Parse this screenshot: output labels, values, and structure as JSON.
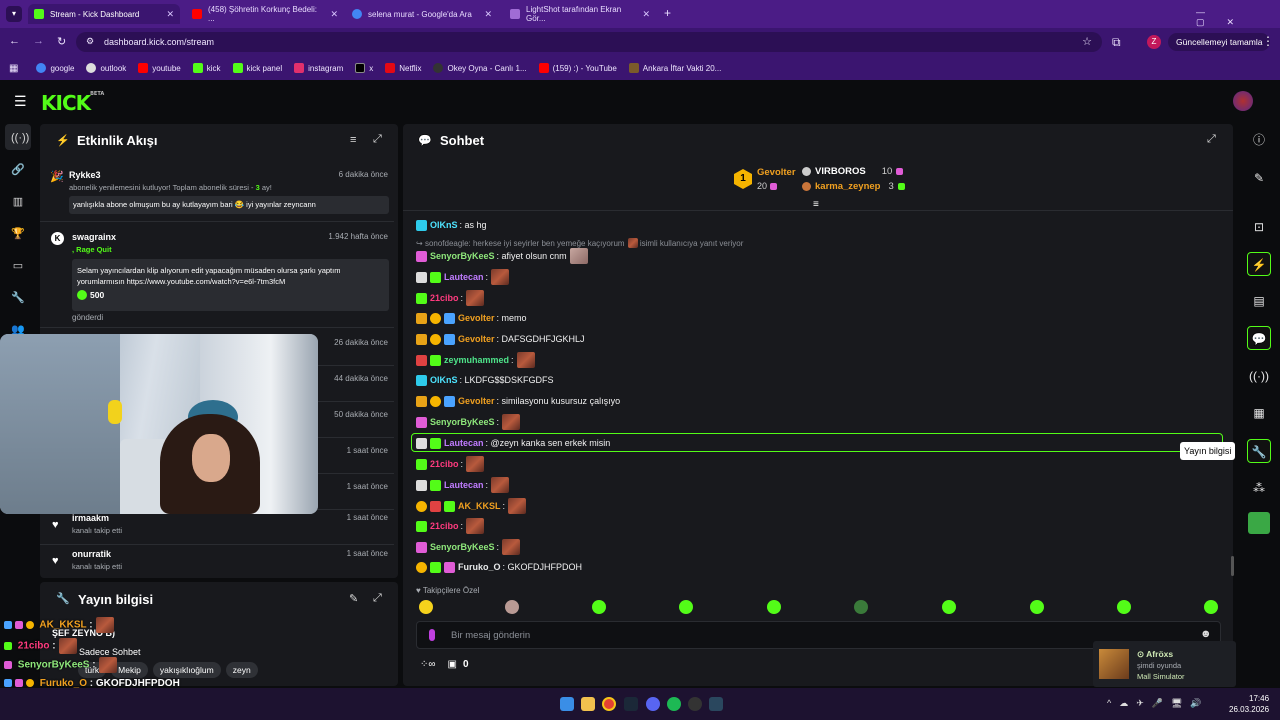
{
  "browser": {
    "tabs": [
      {
        "title": "Stream - Kick Dashboard",
        "color": "#53fc18"
      },
      {
        "title": "(458) Şöhretin Korkunç Bedeli: ...",
        "color": "#ff0000"
      },
      {
        "title": "selena murat - Google'da Ara",
        "color": "#4285f4"
      },
      {
        "title": "LightShot tarafından Ekran Gör...",
        "color": "#a06cd5"
      }
    ],
    "url": "dashboard.kick.com/stream",
    "update_label": "Güncellemeyi tamamla",
    "profile_letter": "Z",
    "bookmarks": [
      {
        "label": "google",
        "color": "#4285f4"
      },
      {
        "label": "outlook",
        "color": "#0a64d6"
      },
      {
        "label": "youtube",
        "color": "#ff0000"
      },
      {
        "label": "kick",
        "color": "#53fc18"
      },
      {
        "label": "kick panel",
        "color": "#53fc18"
      },
      {
        "label": "instagram",
        "color": "#e1306c"
      },
      {
        "label": "x",
        "color": "#000000"
      },
      {
        "label": "Netflix",
        "color": "#e50914"
      },
      {
        "label": "Okey Oyna - Canlı 1...",
        "color": "#333333"
      },
      {
        "label": "(159) :) - YouTube",
        "color": "#ff0000"
      },
      {
        "label": "Ankara İftar Vakti 20...",
        "color": "#222222"
      }
    ]
  },
  "kick": {
    "logo": "KICK",
    "logo_beta": "BETA"
  },
  "activity": {
    "title": "Etkinlik Akışı",
    "items": [
      {
        "name": "Rykke3",
        "time": "6 dakika önce",
        "line": "abonelik yenilemesini kutluyor! Toplam abonelik süresi - ",
        "months": "3",
        "month_suffix": " ay!",
        "message": "yanlışıkla abone olmuşum bu ay kutlayayım bari 😂 iyi yayınlar zeyncann"
      },
      {
        "name": "swagrainx",
        "time": "1.942 hafta önce",
        "tag": ", Rage Quit",
        "message": "Selam yayıncılardan klip alıyorum edit yapacağım müsaden olursa şarkı yaptım yorumlarmısın https://www.youtube.com/watch?v=e6l-7tm3fcM",
        "amount": "500",
        "footer": "gönderdi"
      },
      {
        "time": "26 dakika önce"
      },
      {
        "time": "44 dakika önce"
      },
      {
        "time": "50 dakika önce"
      },
      {
        "time": "1 saat önce"
      },
      {
        "time": "1 saat önce"
      },
      {
        "name": "irmaakm",
        "time": "1 saat önce",
        "sub": "kanalı takip etti"
      },
      {
        "name": "onurratik",
        "time": "1 saat önce",
        "sub": "kanalı takip etti"
      }
    ]
  },
  "stream_info": {
    "title": "Yayın bilgisi",
    "stream_title": "ŞEF ZEYNO B)",
    "category": "Sadece Sohbet",
    "tags": [
      "türk",
      "Mekip",
      "yakışıklıoğlum",
      "zeyn"
    ]
  },
  "chat": {
    "title": "Sohbet",
    "leaderboard": {
      "first": {
        "name": "Gevolter",
        "rank": "1",
        "value": "20"
      },
      "second": {
        "name": "VIRBOROS",
        "value": "10"
      },
      "third": {
        "name": "karma_zeynep",
        "value": "3"
      }
    },
    "reply_context": "sonofdeagle: herkese iyi seyirler ben yemeğe kaçıyorum",
    "reply_suffix": "isimli kullanıcıya yanıt veriyor",
    "messages": [
      {
        "user": "OlKnS",
        "text": "as hg",
        "color": "#4ee4ff"
      },
      {
        "user": "SenyorByKeeS",
        "text": "afiyet olsun cnm",
        "color": "#8ee77b"
      },
      {
        "user": "Lautecan",
        "text": "",
        "color": "#c07cff"
      },
      {
        "user": "21cibo",
        "text": "",
        "color": "#ff3b7f"
      },
      {
        "user": "Gevolter",
        "text": "memo",
        "color": "#f0a020"
      },
      {
        "user": "Gevolter",
        "text": "DAFSGDHFJGKHLJ",
        "color": "#f0a020"
      },
      {
        "user": "zeymuhammed",
        "text": "",
        "color": "#4ee48a"
      },
      {
        "user": "OlKnS",
        "text": "LKDFG$$DSKFGDFS",
        "color": "#4ee4ff"
      },
      {
        "user": "Gevolter",
        "text": "similasyonu kusursuz çalışıyo",
        "color": "#f0a020"
      },
      {
        "user": "SenyorByKeeS",
        "text": "",
        "color": "#8ee77b"
      },
      {
        "user": "Lautecan",
        "text": "@zeyn kanka sen erkek misin",
        "color": "#c07cff"
      },
      {
        "user": "21cibo",
        "text": "",
        "color": "#ff3b7f"
      },
      {
        "user": "Lautecan",
        "text": "",
        "color": "#c07cff"
      },
      {
        "user": "AK_KKSL",
        "text": "",
        "color": "#f0a020"
      },
      {
        "user": "21cibo",
        "text": "",
        "color": "#ff3b7f"
      },
      {
        "user": "SenyorByKeeS",
        "text": "",
        "color": "#8ee77b"
      },
      {
        "user": "Furuko_O",
        "text": "GKOFDJHFPDOH",
        "color": "#e7e9ea"
      }
    ],
    "followers_label": "Takipçilere Özel",
    "input_placeholder": "Bir mesaj gönderin",
    "points": "0",
    "tooltip": "Yayın bilgisi"
  },
  "overlay_chat": [
    {
      "user": "AK_KKSL",
      "text": "",
      "color": "#f0a020"
    },
    {
      "user": "21cibo",
      "text": "",
      "color": "#ff3b7f"
    },
    {
      "user": "SenyorByKeeS",
      "text": "",
      "color": "#8ee77b"
    },
    {
      "user": "Furuko_O",
      "text": "GKOFDJHFPDOH",
      "color": "#f0a020"
    }
  ],
  "notification": {
    "name": "Afröxs",
    "status": "şimdi oyunda",
    "game": "Mall Simulator"
  },
  "taskbar": {
    "time": "17:46",
    "date": "26.03.2026"
  }
}
